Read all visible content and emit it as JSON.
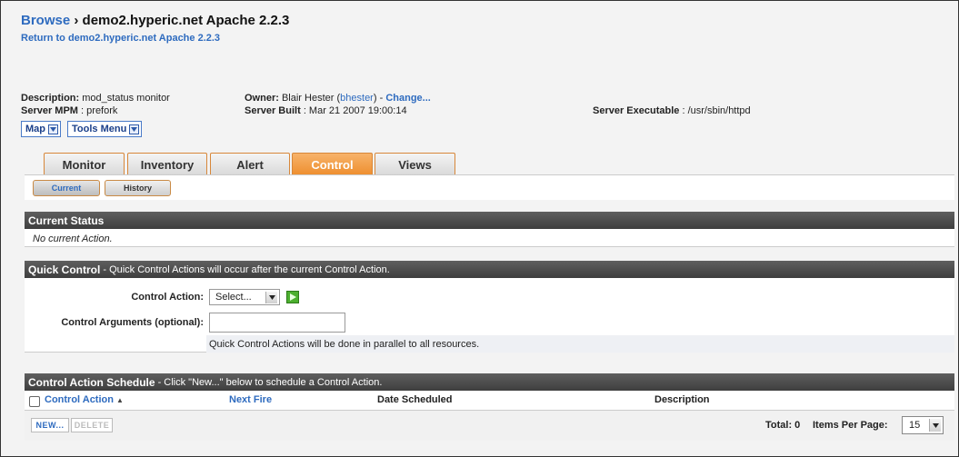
{
  "header": {
    "breadcrumb_root": "Browse",
    "breadcrumb_sep": "›",
    "breadcrumb_current": "demo2.hyperic.net Apache 2.2.3",
    "return_link": "Return to demo2.hyperic.net Apache 2.2.3"
  },
  "meta": {
    "description_label": "Description:",
    "description_value": "mod_status monitor",
    "mpm_label": "Server MPM",
    "mpm_value": ": prefork",
    "owner_label": "Owner:",
    "owner_name": "Blair Hester (",
    "owner_user": "bhester",
    "owner_sep": ") -",
    "change_link": "Change...",
    "built_label": "Server Built",
    "built_value": ": Mar 21 2007 19:00:14",
    "exec_label": "Server Executable",
    "exec_value": ": /usr/sbin/httpd"
  },
  "menus": {
    "map_label": "Map",
    "tools_label": "Tools Menu"
  },
  "tabs": [
    {
      "label": "Monitor"
    },
    {
      "label": "Inventory"
    },
    {
      "label": "Alert"
    },
    {
      "label": "Control"
    },
    {
      "label": "Views"
    }
  ],
  "active_tab": "Control",
  "subtabs": [
    {
      "label": "Current"
    },
    {
      "label": "History"
    }
  ],
  "current_status": {
    "title": "Current Status",
    "message": "No current Action."
  },
  "quick_control": {
    "title": "Quick Control",
    "desc": "- Quick Control Actions will occur after the current Control Action.",
    "action_label": "Control Action:",
    "action_selected": "Select...",
    "args_label": "Control Arguments (optional):",
    "args_value": "",
    "hint": "Quick Control Actions will be done in parallel to all resources."
  },
  "schedule": {
    "title": "Control Action Schedule",
    "desc": "- Click \"New...\" below to schedule a Control Action.",
    "columns": [
      "Control Action",
      "Next Fire",
      "Date Scheduled",
      "Description"
    ],
    "sort_indicator": "▲",
    "new_label": "NEW...",
    "delete_label": "DELETE",
    "total_label": "Total: 0",
    "items_per_page_label": "Items Per Page:",
    "items_per_page_value": "15"
  },
  "colors": {
    "link": "#2e6bbf",
    "active_tab": "#ee8e2e",
    "section_bar": "#4a4a4a"
  }
}
